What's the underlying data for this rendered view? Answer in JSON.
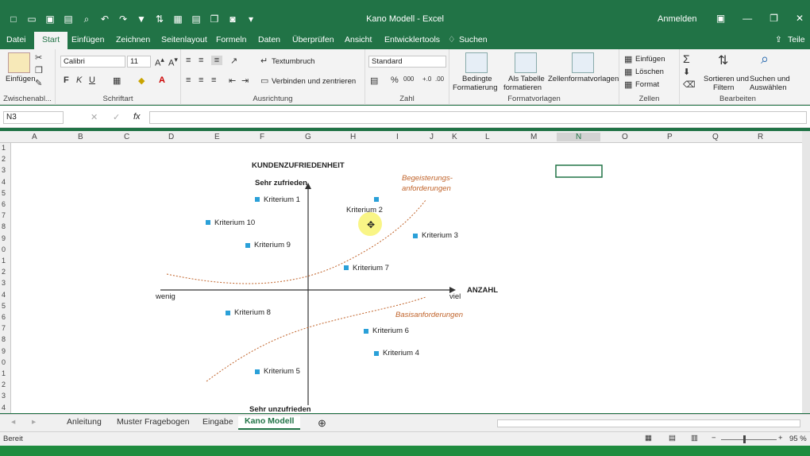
{
  "window": {
    "title": "Kano Modell - Excel",
    "signin": "Anmelden"
  },
  "tabs": [
    "Datei",
    "Start",
    "Einfügen",
    "Zeichnen",
    "Seitenlayout",
    "Formeln",
    "Daten",
    "Überprüfen",
    "Ansicht",
    "Entwicklertools"
  ],
  "tell_me": "Suchen",
  "share": "Teile",
  "ribbon": {
    "clipboard": {
      "paste": "Einfügen",
      "label": "Zwischenabl..."
    },
    "font": {
      "name": "Calibri",
      "size": "11",
      "label": "Schriftart"
    },
    "alignment": {
      "wrap": "Textumbruch",
      "merge": "Verbinden und zentrieren",
      "label": "Ausrichtung"
    },
    "number": {
      "format": "Standard",
      "label": "Zahl"
    },
    "styles": {
      "cond": "Bedingte",
      "cond2": "Formatierung",
      "table": "Als Tabelle",
      "table2": "formatieren",
      "cellstyles": "Zellenformatvorlagen",
      "label": "Formatvorlagen"
    },
    "cells": {
      "insert": "Einfügen",
      "delete": "Löschen",
      "format": "Format",
      "label": "Zellen"
    },
    "editing": {
      "sort": "Sortieren und",
      "sort2": "Filtern",
      "find": "Suchen und",
      "find2": "Auswählen",
      "label": "Bearbeiten"
    }
  },
  "formula_bar": {
    "namebox": "N3",
    "fx": "fx"
  },
  "columns": [
    "A",
    "B",
    "C",
    "D",
    "E",
    "F",
    "G",
    "H",
    "I",
    "J",
    "K",
    "L",
    "M",
    "N",
    "O",
    "P",
    "Q",
    "R"
  ],
  "rows": [
    "1",
    "2",
    "3",
    "4",
    "5",
    "6",
    "7",
    "8",
    "9",
    "0",
    "1",
    "2",
    "3",
    "4",
    "5",
    "6",
    "7",
    "8",
    "9",
    "0",
    "1",
    "2",
    "3",
    "4"
  ],
  "chart": {
    "title": "KUNDENZUFRIEDENHEIT",
    "top_label": "Sehr zufrieden",
    "bottom_label": "Sehr unzufrieden",
    "x_left": "wenig",
    "x_right": "viel",
    "x_title": "ANZAHL",
    "anno_top_1": "Begeisterungs-",
    "anno_top_2": "anforderungen",
    "anno_bottom": "Basisanforderungen",
    "points": [
      {
        "label": "Kriterium 1"
      },
      {
        "label": "Kriterium 2"
      },
      {
        "label": "Kriterium 3"
      },
      {
        "label": "Kriterium 4"
      },
      {
        "label": "Kriterium 5"
      },
      {
        "label": "Kriterium 6"
      },
      {
        "label": "Kriterium 7"
      },
      {
        "label": "Kriterium 8"
      },
      {
        "label": "Kriterium 9"
      },
      {
        "label": "Kriterium 10"
      }
    ],
    "accent": "#2aa0d8",
    "annotation_color": "#c0632a"
  },
  "sheet_tabs": [
    "Anleitung",
    "Muster Fragebogen",
    "Eingabe",
    "Kano Modell"
  ],
  "active_sheet": "Kano Modell",
  "status": {
    "ready": "Bereit",
    "zoom": "95 %"
  }
}
